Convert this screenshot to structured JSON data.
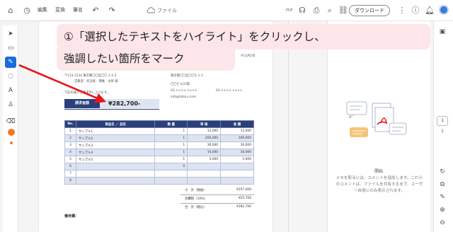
{
  "topbar": {
    "menu_edit": "編集",
    "menu_convert": "変換",
    "menu_sign": "署名",
    "file_name": "ファイル",
    "pdf_label": "PDF",
    "download_label": "ダウンロード",
    "icons": [
      "home-icon",
      "history-icon",
      "undo-icon",
      "redo-icon",
      "cloud-icon",
      "headphones-icon",
      "print-icon",
      "search-icon",
      "link-icon",
      "more-icon",
      "help-icon",
      "bell-icon",
      "avatar"
    ]
  },
  "left_tools": [
    "select-icon",
    "comment-icon",
    "highlight-icon",
    "lasso-icon",
    "text-icon",
    "stamp-icon",
    "eraser-icon"
  ],
  "tool_color": "#f07a26",
  "document": {
    "date": "#12月2日",
    "sender_addr1": "〒123-1234 東京都〇〇区〇〇 1-2-3",
    "sender_dept": "営業部　担当者：債権　太郎 様",
    "recipient_addr1": "東京都〇〇区〇〇1-1-1",
    "recipient_bldg": "〇〇ビル31階",
    "recipient_tel": "03-××××-××××",
    "recipient_fax": "03-××××-××××",
    "recipient_email": "info@tatoru.com",
    "intro": "下記の通りご請求申し上げます。",
    "invoice_label": "請求金額",
    "invoice_amount": "¥282,700-",
    "table_headers": [
      "No.",
      "商品名 ／ 品名",
      "数 量",
      "単 価",
      "金 額"
    ],
    "rows": [
      {
        "no": "1",
        "name": "サンプル1",
        "qty": "1",
        "price": "12,000",
        "amount": "12,000"
      },
      {
        "no": "2",
        "name": "サンプル2",
        "qty": "1",
        "price": "200,000",
        "amount": "200,000"
      },
      {
        "no": "3",
        "name": "サンプル3",
        "qty": "1",
        "price": "30,000",
        "amount": "30,000"
      },
      {
        "no": "4",
        "name": "サンプル4",
        "qty": "1",
        "price": "10,000",
        "amount": "10,000"
      },
      {
        "no": "5",
        "name": "サンプル5",
        "qty": "1",
        "price": "5,000",
        "amount": "5,000"
      },
      {
        "no": "6",
        "name": "",
        "qty": "0",
        "price": "",
        "amount": ""
      },
      {
        "no": "7",
        "name": "",
        "qty": "",
        "price": "",
        "amount": ""
      },
      {
        "no": "8",
        "name": "",
        "qty": "",
        "price": "",
        "amount": ""
      }
    ],
    "subtotal_label": "小　計（税抜）",
    "subtotal_value": "¥257,000",
    "tax_label": "消費税（10%）",
    "tax_value": "¥25,700",
    "total_label": "合　計（税込）",
    "total_value": "¥282,700",
    "remarks_label": "備考欄："
  },
  "comments_panel": {
    "heading": "開始",
    "hint": "メモを取るには、コメントを追加します。これらのコメントは、ファイルを共有するまで、ユーザー自身にのみ表示されます。"
  },
  "right_rail": {
    "page_current": "1",
    "page_total": "1",
    "icons": [
      "comment-panel-icon",
      "refresh-icon",
      "copy-icon",
      "annotate-icon",
      "zoom-in-icon",
      "zoom-out-icon"
    ]
  },
  "callout": {
    "line1": "①「選択したテキストをハイライト」をクリックし、",
    "line2": "強調したい箇所をマーク",
    "background": "#fde6ea",
    "arrow_color": "#e8141c"
  }
}
